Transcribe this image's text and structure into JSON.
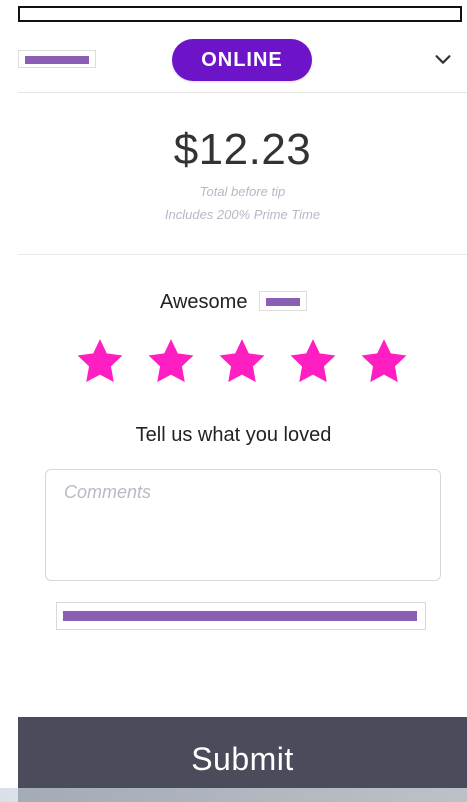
{
  "header": {
    "status_label": "ONLINE",
    "chevron_icon": "chevron-down-icon"
  },
  "fare": {
    "amount": "$12.23",
    "subtitle": "Total before tip",
    "note": "Includes 200% Prime Time"
  },
  "rating": {
    "label": "Awesome",
    "stars_selected": 5,
    "stars_total": 5,
    "star_color": "#ff1ec1"
  },
  "feedback": {
    "prompt": "Tell us what you loved",
    "comments_placeholder": "Comments",
    "comments_value": ""
  },
  "actions": {
    "submit_label": "Submit"
  },
  "colors": {
    "online_pill": "#6d14c8",
    "submit_bar": "#4a4c5b",
    "redaction": "#8a5fb3"
  }
}
